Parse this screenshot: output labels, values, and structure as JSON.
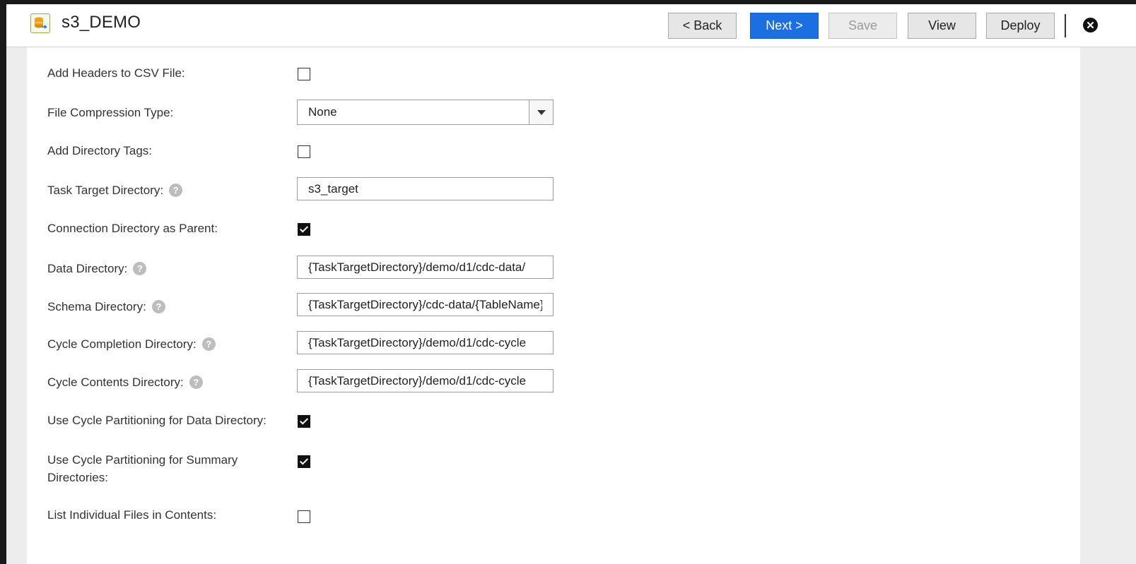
{
  "header": {
    "title": "s3_DEMO",
    "app_icon": "database-task-icon",
    "buttons": {
      "back": "< Back",
      "next": "Next >",
      "save": "Save",
      "view": "View",
      "deploy": "Deploy"
    },
    "close_icon": "close-icon",
    "close_glyph": "✕"
  },
  "help_glyph": "?",
  "form": {
    "add_headers": {
      "label": "Add Headers to CSV File:",
      "checked": false
    },
    "file_compression": {
      "label": "File Compression Type:",
      "value": "None"
    },
    "add_directory_tags": {
      "label": "Add Directory Tags:",
      "checked": false
    },
    "task_target_directory": {
      "label": "Task Target Directory:",
      "value": "s3_target"
    },
    "connection_directory_parent": {
      "label": "Connection Directory as Parent:",
      "checked": true
    },
    "data_directory": {
      "label": "Data Directory:",
      "value": "{TaskTargetDirectory}/demo/d1/cdc-data/"
    },
    "schema_directory": {
      "label": "Schema Directory:",
      "value": "{TaskTargetDirectory}/cdc-data/{TableName}"
    },
    "cycle_completion_directory": {
      "label": "Cycle Completion Directory:",
      "value": "{TaskTargetDirectory}/demo/d1/cdc-cycle"
    },
    "cycle_contents_directory": {
      "label": "Cycle Contents Directory:",
      "value": "{TaskTargetDirectory}/demo/d1/cdc-cycle"
    },
    "cycle_partition_data": {
      "label": "Use Cycle Partitioning for Data Directory:",
      "checked": true
    },
    "cycle_partition_summary": {
      "label_line1": "Use Cycle Partitioning for Summary",
      "label_line2": "Directories:",
      "checked": true
    },
    "list_individual_files": {
      "label": "List Individual Files in Contents:",
      "checked": false
    }
  },
  "colors": {
    "primary": "#1b6fe0",
    "background": "#ededed",
    "panel": "#ffffff"
  }
}
